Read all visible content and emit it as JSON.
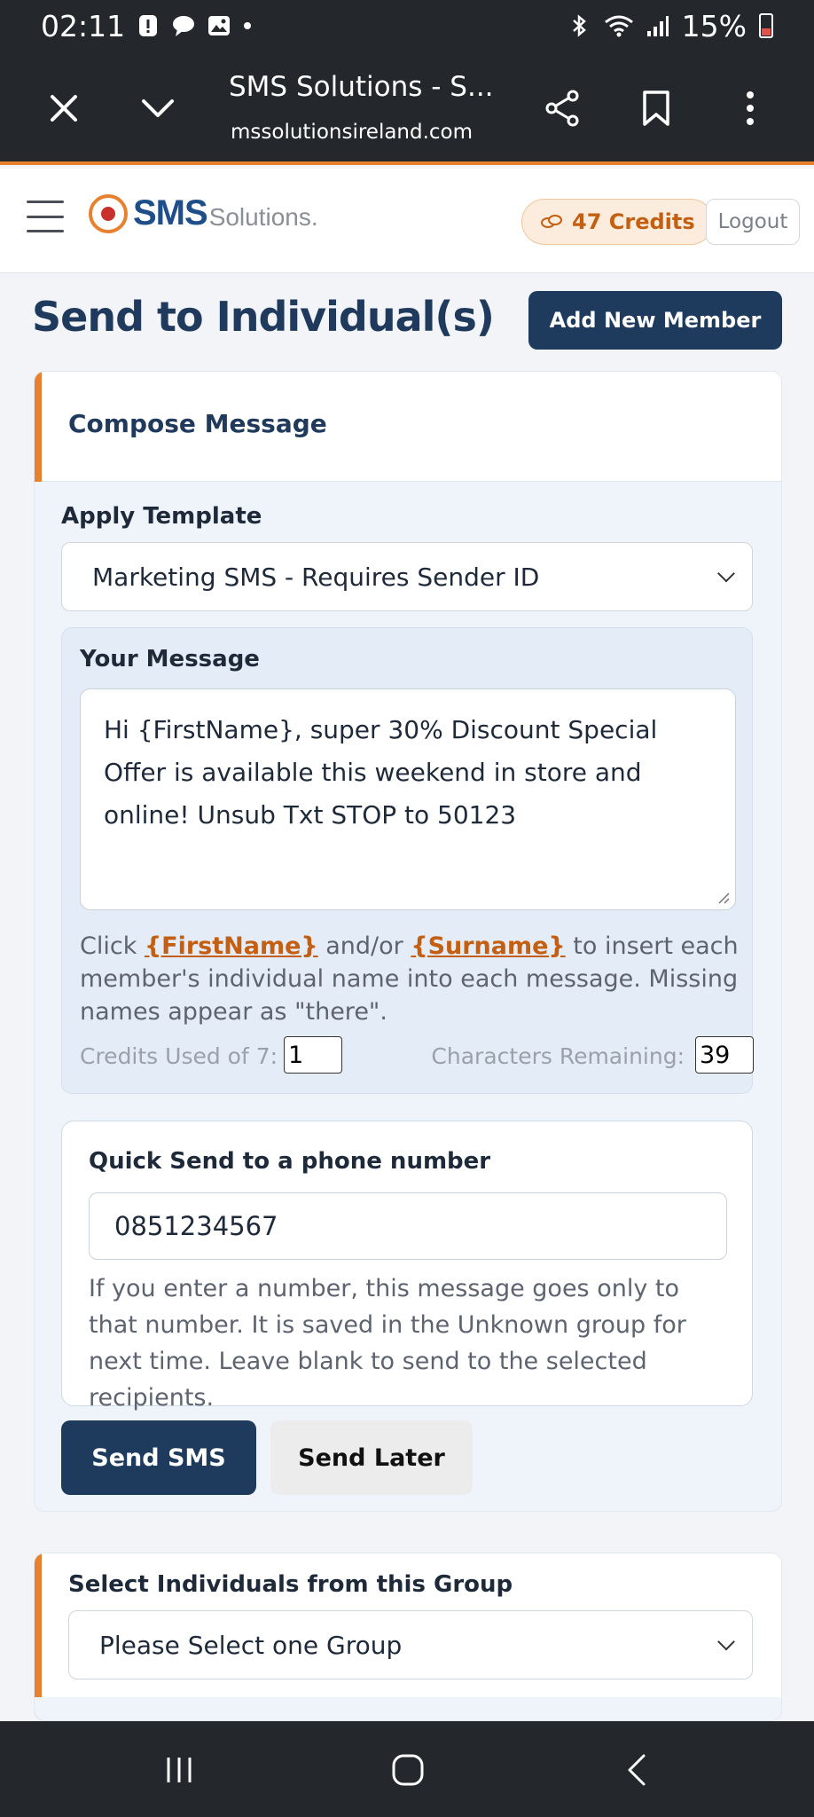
{
  "status_bar": {
    "time": "02:11",
    "battery": "15%",
    "icons": [
      "alert-icon",
      "chat-bubble-icon",
      "image-icon",
      "dot-icon",
      "bluetooth-icon",
      "wifi-icon",
      "signal-icon",
      "battery-icon"
    ]
  },
  "browser": {
    "title": "SMS Solutions - S...",
    "url": "mssolutionsireland.com"
  },
  "header": {
    "logo_main": "SMS",
    "logo_sub": "Solutions.",
    "credits": "47 Credits",
    "logout": "Logout"
  },
  "page": {
    "title": "Send to Individual(s)",
    "add_member": "Add New Member"
  },
  "compose": {
    "heading": "Compose Message",
    "template_label": "Apply Template",
    "template_selected": "Marketing SMS - Requires Sender ID",
    "message_label": "Your Message",
    "message": "Hi {FirstName}, super 30% Discount Special Offer is available this weekend in store and online! Unsub Txt STOP to 50123",
    "hint_prefix": "Click",
    "hint_firstname": "{FirstName}",
    "hint_and": "and/or",
    "hint_surname": "{Surname}",
    "hint_suffix": "to insert each member's individual name into each message. Missing names appear as \"there\".",
    "credits_used_label": "Credits Used of 7:",
    "credits_used": "1",
    "chars_remaining_label": "Characters Remaining:",
    "chars_remaining": "39"
  },
  "quick_send": {
    "label": "Quick Send to a phone number",
    "phone": "0851234567",
    "hint": "If you enter a number, this message goes only to that number. It is saved in the Unknown group for next time. Leave blank to send to the selected recipients."
  },
  "actions": {
    "send": "Send SMS",
    "later": "Send Later"
  },
  "group": {
    "label": "Select Individuals from this Group",
    "selected": "Please Select one Group"
  },
  "colors": {
    "accent_orange": "#e8812f",
    "navy": "#1e3a5c",
    "system_bar": "#24272c"
  }
}
